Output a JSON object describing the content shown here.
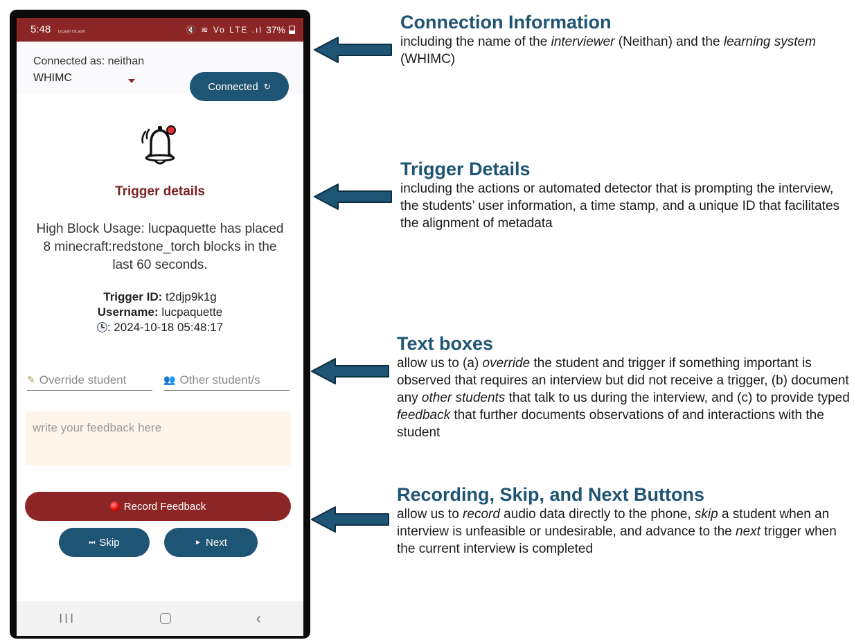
{
  "status_bar": {
    "time": "5:48",
    "small_labels": "GCash GCash",
    "icons": "🔇 ≋ Vo LTE .ıl",
    "battery": "37%"
  },
  "connection": {
    "label": "Connected as: neithan",
    "system": "WHIMC",
    "button_label": "Connected",
    "button_icon": "↻"
  },
  "trigger": {
    "title": "Trigger details",
    "description": "High Block Usage: lucpaquette has placed 8 minecraft:redstone_torch blocks in the last 60 seconds.",
    "id_label": "Trigger ID:",
    "id_value": "t2djp9k1g",
    "username_label": "Username:",
    "username_value": "lucpaquette",
    "timestamp": ": 2024-10-18 05:48:17"
  },
  "inputs": {
    "override_placeholder": "Override student",
    "other_placeholder": "Other student/s",
    "feedback_placeholder": "write your feedback here"
  },
  "buttons": {
    "record": "Record Feedback",
    "skip": "Skip",
    "skip_glyph": "⏭",
    "next": "Next",
    "next_glyph": "►"
  },
  "nav": {
    "recents": "III",
    "back": "‹"
  },
  "annotations": [
    {
      "title": "Connection Information",
      "body_parts": [
        "including the name of the ",
        "interviewer",
        " (Neithan) and the  ",
        "learning system",
        " (WHIMC)"
      ]
    },
    {
      "title": "Trigger Details",
      "body": "including the actions or automated detector that is prompting the interview, the students’ user information, a time stamp, and a unique ID that facilitates the alignment of metadata"
    },
    {
      "title": "Text boxes",
      "body_parts": [
        "allow us to (a) ",
        "override",
        " the student and trigger if something important is observed that requires an interview but did not receive a trigger, (b) document any ",
        "other students",
        " that talk to us during the interview, and (c) to provide typed ",
        "feedback",
        " that further documents observations of and interactions with the student"
      ]
    },
    {
      "title": "Recording, Skip, and Next Buttons",
      "body_parts": [
        "allow us to ",
        "record",
        " audio data directly to the phone, ",
        "skip",
        " a student when an interview is unfeasible or undesirable, and advance to the ",
        "next",
        " trigger when the current interview is completed"
      ]
    }
  ],
  "colors": {
    "brand_red": "#8c2626",
    "brand_blue": "#1e5474",
    "feedback_bg": "#fff5ea"
  }
}
